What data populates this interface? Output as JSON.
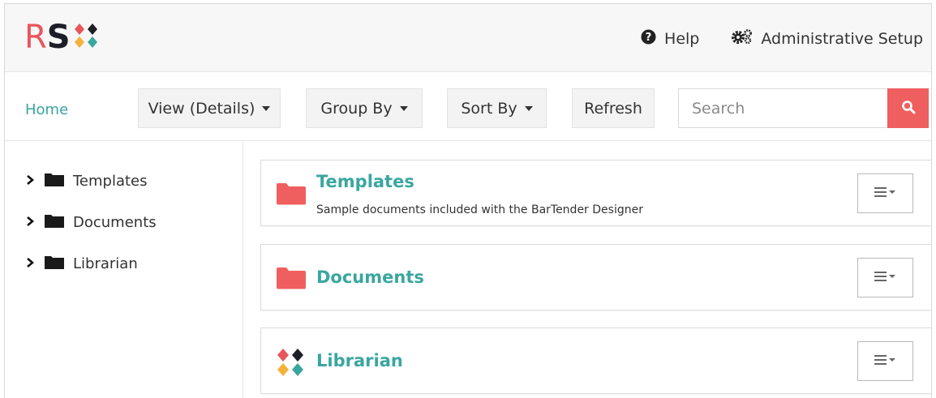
{
  "header": {
    "logo": {
      "letters": [
        "R",
        "S"
      ],
      "mark_colors": [
        "#e8565b",
        "#1e1e28",
        "#f4b23c",
        "#3aa6a0"
      ]
    },
    "links": [
      {
        "label": "Help",
        "icon": "question-circle-icon"
      },
      {
        "label": "Administrative Setup",
        "icon": "gears-icon"
      }
    ]
  },
  "toolbar": {
    "home_label": "Home",
    "buttons": [
      {
        "label": "View (Details)",
        "dropdown": true
      },
      {
        "label": "Group By",
        "dropdown": true
      },
      {
        "label": "Sort By",
        "dropdown": true
      },
      {
        "label": "Refresh",
        "dropdown": false
      }
    ],
    "search": {
      "placeholder": "Search",
      "value": "",
      "button_icon": "search-icon"
    }
  },
  "sidebar": {
    "items": [
      {
        "label": "Templates",
        "icon": "folder-icon",
        "expander": "chevron-right-icon"
      },
      {
        "label": "Documents",
        "icon": "folder-icon",
        "expander": "chevron-right-icon"
      },
      {
        "label": "Librarian",
        "icon": "folder-icon",
        "expander": "chevron-right-icon"
      }
    ]
  },
  "main": {
    "items": [
      {
        "title": "Templates",
        "description": "Sample documents included with the BarTender Designer",
        "icon": "folder-icon"
      },
      {
        "title": "Documents",
        "description": "",
        "icon": "folder-icon"
      },
      {
        "title": "Librarian",
        "description": "",
        "icon": "librarian-logo-icon"
      }
    ],
    "menu_icon": "hamburger-dropdown-icon"
  },
  "colors": {
    "accent": "#3aa6a0",
    "search_button": "#ef5f5f",
    "folder_red": "#ef5f5f",
    "dark": "#1e1e28",
    "yellow": "#f4b23c"
  }
}
